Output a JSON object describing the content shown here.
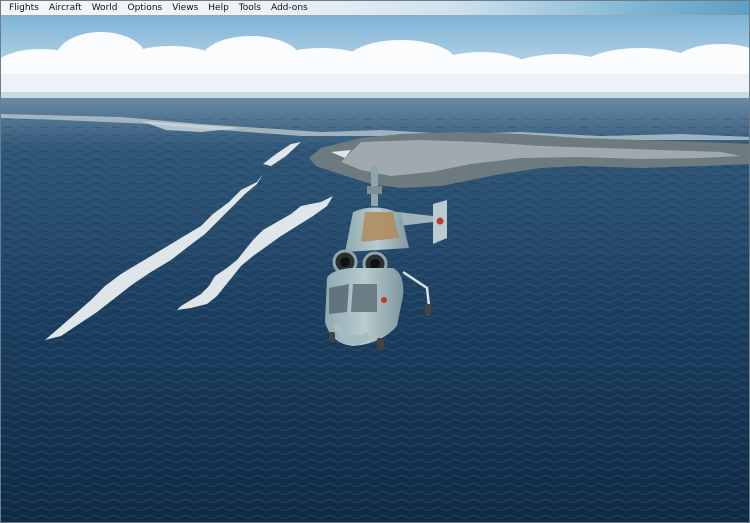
{
  "menu": [
    "Flights",
    "Aircraft",
    "World",
    "Options",
    "Views",
    "Help",
    "Tools",
    "Add-ons"
  ],
  "scene": {
    "colors": {
      "sky_top": "#7fb4d6",
      "sky_horizon": "#d6e6ef",
      "sea_far": "#6b8aa3",
      "sea_near": "#0f2a44",
      "land": "#6d7a80",
      "ice": "#dfe5e8",
      "helicopter_body": "#9fb9bf",
      "helicopter_rust": "#b08a5a",
      "star": "#c0392b"
    }
  }
}
